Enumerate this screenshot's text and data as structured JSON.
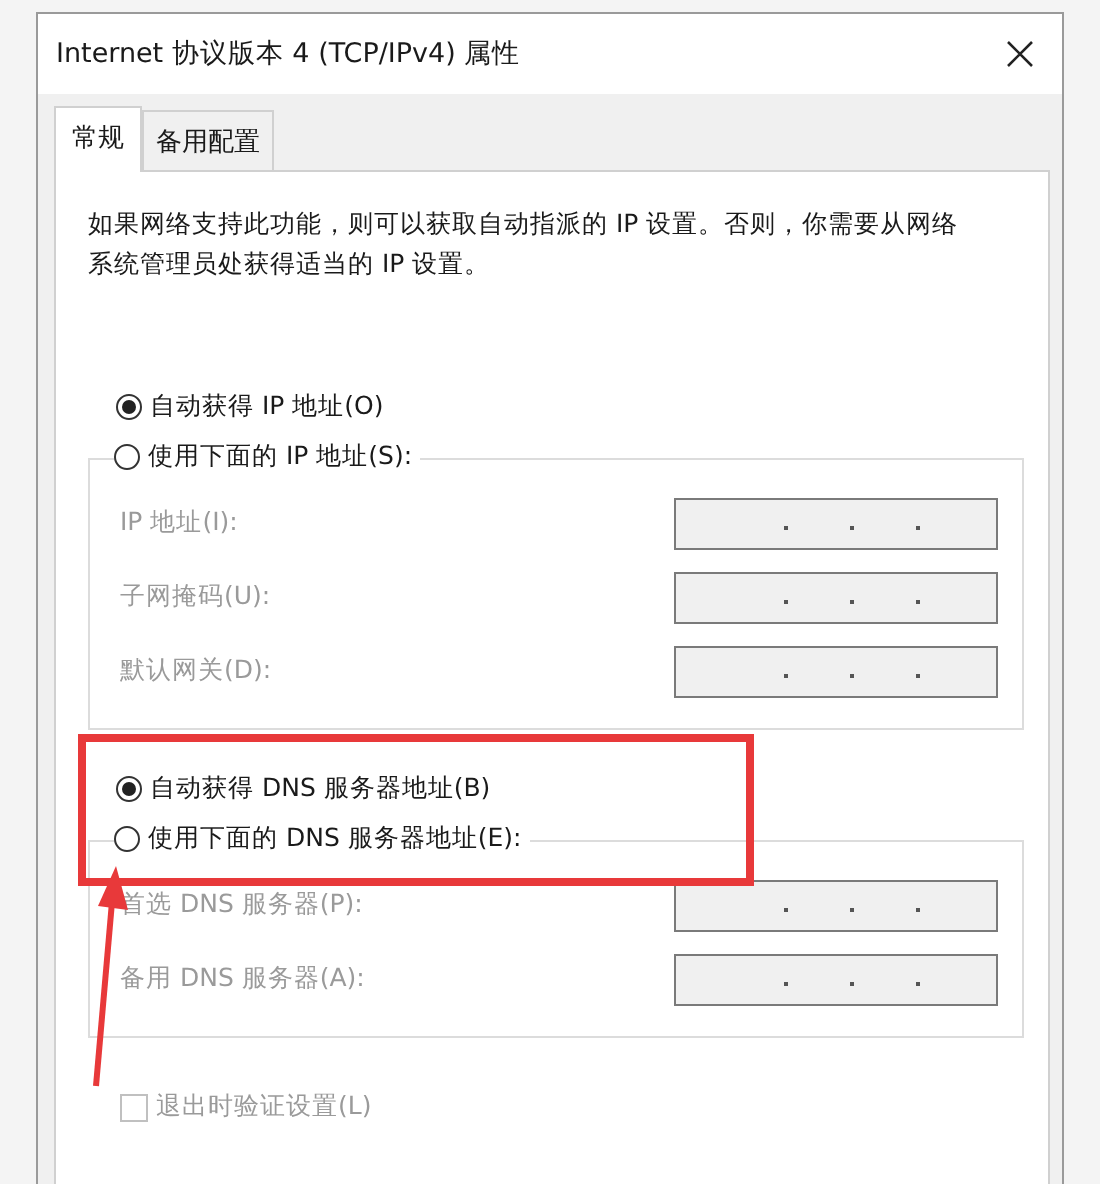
{
  "window": {
    "title": "Internet 协议版本 4 (TCP/IPv4) 属性"
  },
  "tabs": [
    {
      "label": "常规",
      "selected": true
    },
    {
      "label": "备用配置",
      "selected": false
    }
  ],
  "description": "如果网络支持此功能，则可以获取自动指派的 IP 设置。否则，你需要从网络系统管理员处获得适当的 IP 设置。",
  "ip_options": [
    {
      "label": "自动获得 IP 地址(O)",
      "selected": true
    },
    {
      "label": "使用下面的 IP 地址(S):",
      "selected": false
    }
  ],
  "ip_fields": {
    "disabled": true,
    "fields": [
      {
        "label": "IP 地址(I):"
      },
      {
        "label": "子网掩码(U):"
      },
      {
        "label": "默认网关(D):"
      }
    ]
  },
  "dns_options": [
    {
      "label": "自动获得 DNS 服务器地址(B)",
      "selected": true
    },
    {
      "label": "使用下面的 DNS 服务器地址(E):",
      "selected": false
    }
  ],
  "dns_fields": {
    "disabled": true,
    "fields": [
      {
        "label": "首选 DNS 服务器(P):"
      },
      {
        "label": "备用 DNS 服务器(A):"
      }
    ]
  },
  "validate_checkbox": {
    "label": "退出时验证设置(L)",
    "checked": false,
    "disabled": true
  }
}
